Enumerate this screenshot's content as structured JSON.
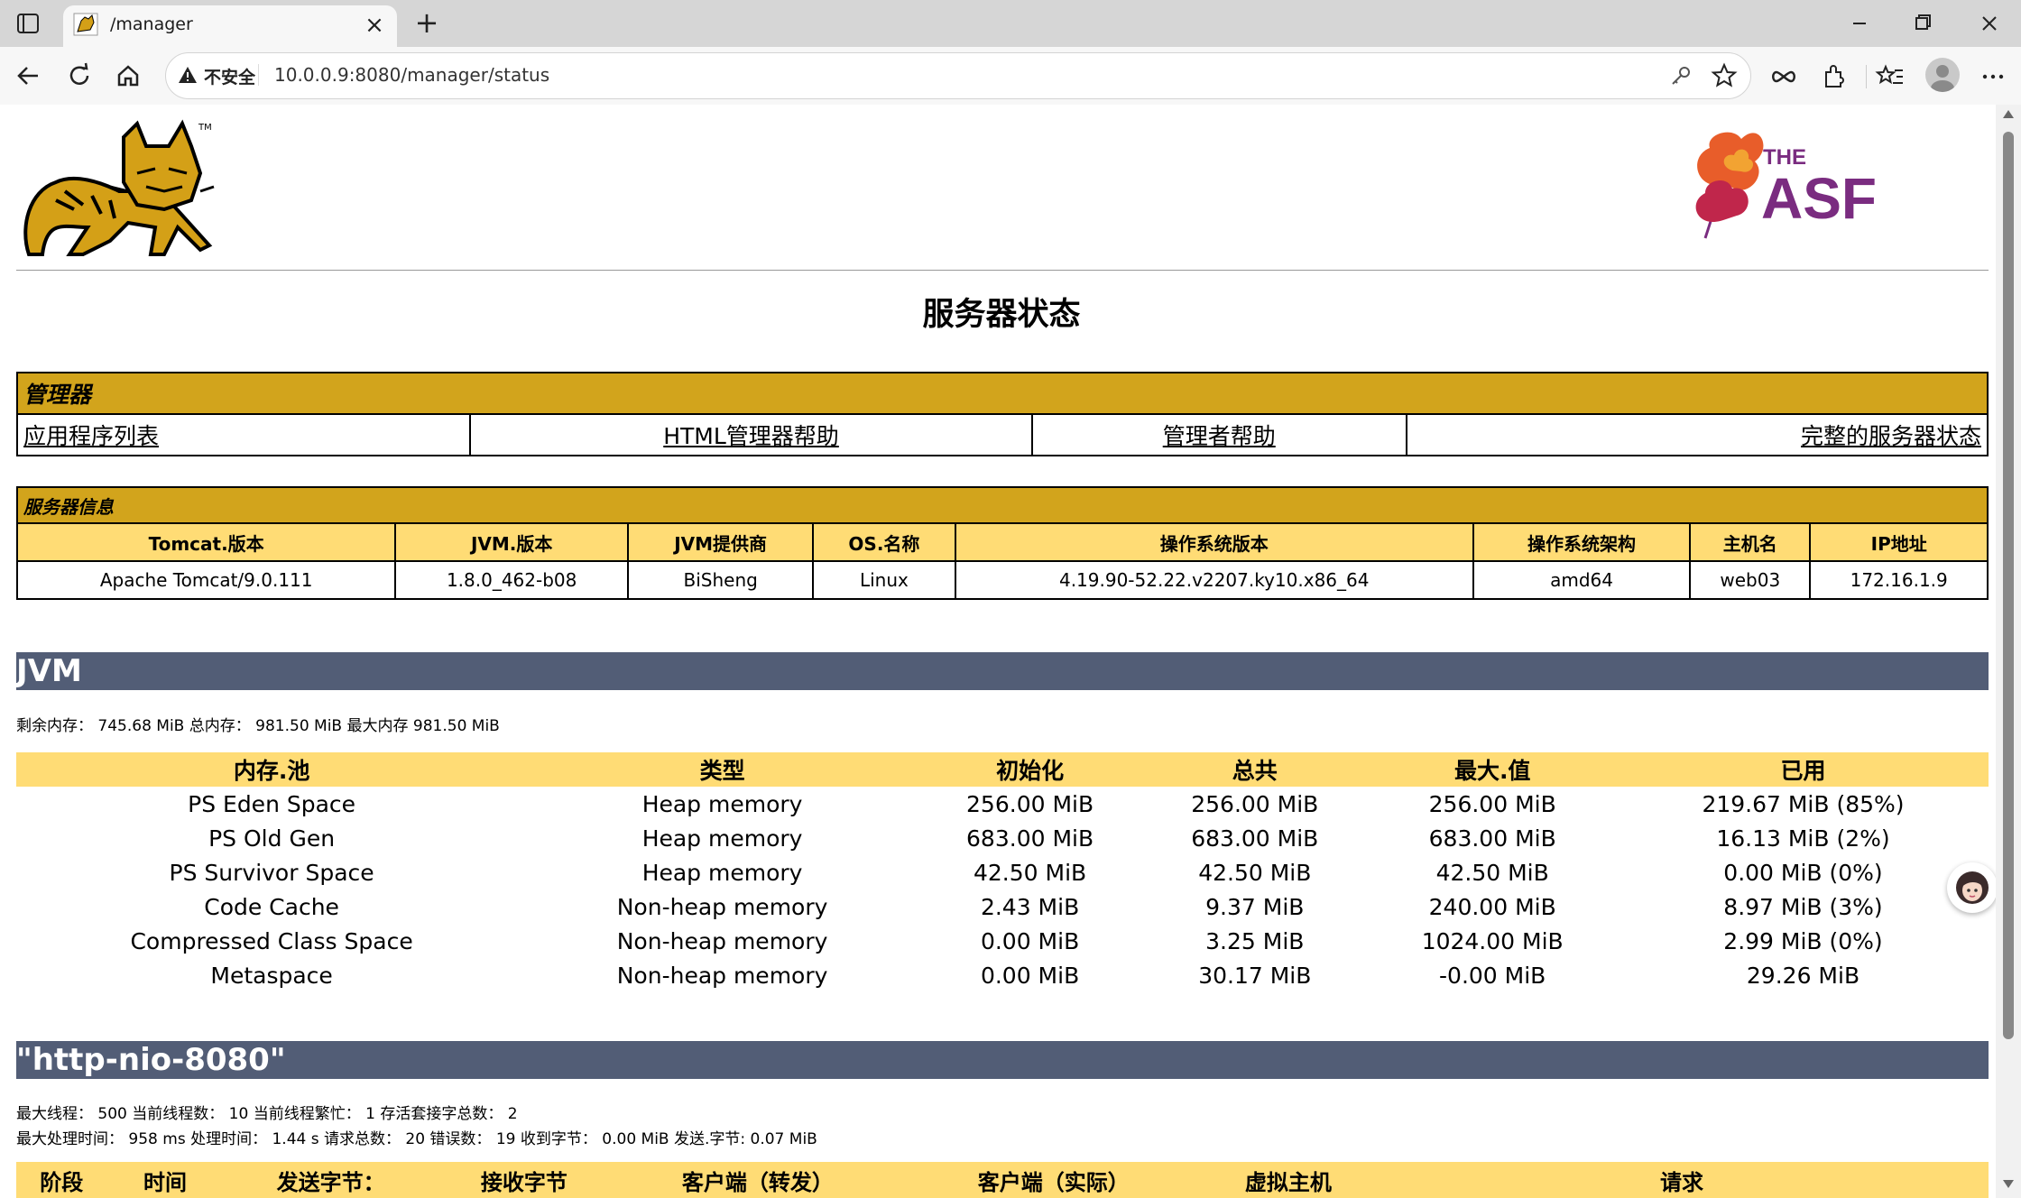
{
  "browser": {
    "tab_title": "/manager",
    "security_label": "不安全",
    "url": "10.0.0.9:8080/manager/status"
  },
  "page": {
    "title": "服务器状态"
  },
  "manager": {
    "heading": "管理器",
    "links": [
      "应用程序列表",
      "HTML管理器帮助",
      "管理者帮助",
      "完整的服务器状态"
    ]
  },
  "server_info": {
    "heading": "服务器信息",
    "columns": [
      "Tomcat.版本",
      "JVM.版本",
      "JVM提供商",
      "OS.名称",
      "操作系统版本",
      "操作系统架构",
      "主机名",
      "IP地址"
    ],
    "values": [
      "Apache Tomcat/9.0.111",
      "1.8.0_462-b08",
      "BiSheng",
      "Linux",
      "4.19.90-52.22.v2207.ky10.x86_64",
      "amd64",
      "web03",
      "172.16.1.9"
    ]
  },
  "jvm": {
    "heading": "JVM",
    "memory_summary": "剩余内存： 745.68 MiB 总内存： 981.50 MiB 最大内存 981.50 MiB",
    "columns": [
      "内存.池",
      "类型",
      "初始化",
      "总共",
      "最大.值",
      "已用"
    ],
    "rows": [
      [
        "PS Eden Space",
        "Heap memory",
        "256.00 MiB",
        "256.00 MiB",
        "256.00 MiB",
        "219.67 MiB (85%)"
      ],
      [
        "PS Old Gen",
        "Heap memory",
        "683.00 MiB",
        "683.00 MiB",
        "683.00 MiB",
        "16.13 MiB (2%)"
      ],
      [
        "PS Survivor Space",
        "Heap memory",
        "42.50 MiB",
        "42.50 MiB",
        "42.50 MiB",
        "0.00 MiB (0%)"
      ],
      [
        "Code Cache",
        "Non-heap memory",
        "2.43 MiB",
        "9.37 MiB",
        "240.00 MiB",
        "8.97 MiB (3%)"
      ],
      [
        "Compressed Class Space",
        "Non-heap memory",
        "0.00 MiB",
        "3.25 MiB",
        "1024.00 MiB",
        "2.99 MiB (0%)"
      ],
      [
        "Metaspace",
        "Non-heap memory",
        "0.00 MiB",
        "30.17 MiB",
        "-0.00 MiB",
        "29.26 MiB"
      ]
    ]
  },
  "connector": {
    "heading": "\"http-nio-8080\"",
    "line1": "最大线程： 500 当前线程数： 10 当前线程繁忙： 1 存活套接字总数： 2",
    "line2": "最大处理时间： 958 ms 处理时间： 1.44 s 请求总数： 20 错误数： 19 收到字节： 0.00 MiB 发送.字节: 0.07 MiB",
    "columns": [
      "阶段",
      "时间",
      "发送字节：",
      "接收字节",
      "客户端（转发）",
      "客户端（实际）",
      "虚拟主机",
      "请求"
    ]
  },
  "colors": {
    "section_gold": "#d2a41c",
    "header_yellow": "#ffdc75",
    "bar_slate": "#525d76"
  },
  "logos": {
    "asf_line1": "THE",
    "asf_line2": "ASF",
    "tomcat_tm": "TM"
  }
}
